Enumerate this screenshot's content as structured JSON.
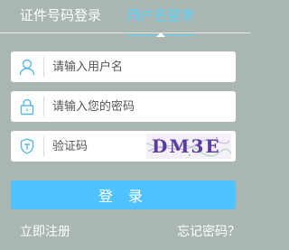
{
  "tabs": [
    {
      "label": "证件号码登录",
      "active": false
    },
    {
      "label": "用户名登录",
      "active": true
    }
  ],
  "username": {
    "placeholder": "请输入用户名",
    "value": "",
    "icon": "user-icon"
  },
  "password": {
    "placeholder": "请输入您的密码",
    "value": "",
    "icon": "lock-icon"
  },
  "captcha": {
    "placeholder": "验证码",
    "value": "",
    "icon": "shield-icon",
    "image_text": "DM3E"
  },
  "login_button": {
    "label": "登 录"
  },
  "links": {
    "register": "立即注册",
    "forgot_password": "忘记密码？"
  },
  "colors": {
    "accent": "#4fc3ff",
    "active_tab": "#57d5ff",
    "icon": "#5bb8e6",
    "background": "#a9b6b1"
  }
}
